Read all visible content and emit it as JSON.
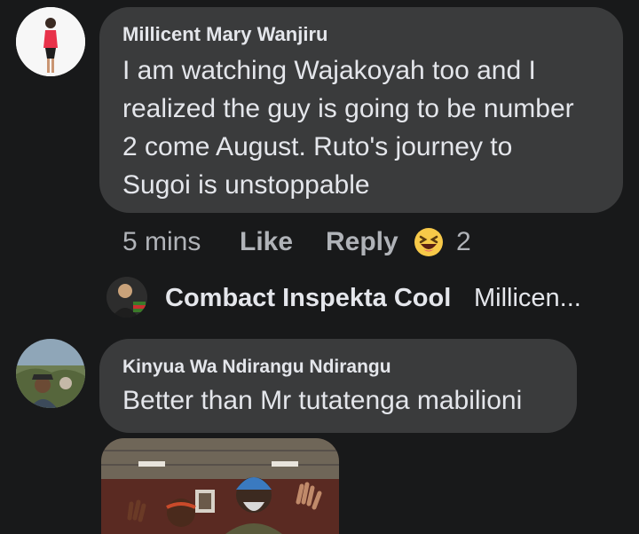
{
  "comments": [
    {
      "author": "Millicent Mary Wanjiru",
      "lines": [
        "I am watching Wajakoyah too and I",
        "realized the guy is going to be number",
        "2 come August. Ruto's journey to",
        "Sugoi is unstoppable"
      ],
      "time": "5 mins",
      "like_label": "Like",
      "reply_label": "Reply",
      "reaction_icon": "laughing-emoji-icon",
      "reaction_count": "2"
    },
    {
      "author": "Kinyua Wa Ndirangu Ndirangu",
      "text": "Better than Mr tutatenga mabilioni"
    }
  ],
  "reply_preview": {
    "author": "Combact Inspekta Cool",
    "snippet": "Millicen..."
  },
  "colors": {
    "background": "#18191a",
    "bubble": "#3a3b3c",
    "text": "#e4e6eb",
    "muted": "#b0b3b8"
  }
}
